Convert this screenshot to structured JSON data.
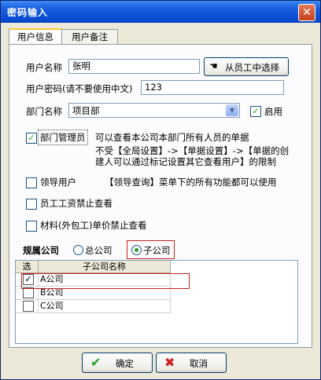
{
  "window": {
    "title": "密码输入",
    "close_symbol": "✕"
  },
  "tabs": [
    {
      "label": "用户信息"
    },
    {
      "label": "用户备注"
    }
  ],
  "form": {
    "username_label": "用户名称",
    "username_value": "张明",
    "select_employee_button": "从员工中选择",
    "password_label": "用户密码(请不要使用中文)",
    "password_value": "123",
    "department_label": "部门名称",
    "department_value": "项目部",
    "enable_label": "启用",
    "enable_checked": true
  },
  "permissions": {
    "dept_manager_label": "部门管理员",
    "dept_manager_checked": true,
    "dept_manager_desc1": "可以查看本公司本部门所有人员的单据",
    "dept_manager_desc2": "不受【全局设置】->【单据设置】->【单据的创",
    "dept_manager_desc3": "建人可以通过标记设置其它查看用户】的限制",
    "leader_label": "领导用户",
    "leader_desc": "【领导查询】菜单下的所有功能都可以使用",
    "salary_label": "员工工资禁止查看",
    "material_label": "材料(外包工)单价禁止查看"
  },
  "company": {
    "label": "规属公司",
    "option_head": "总公司",
    "option_sub": "子公司",
    "selected": "子公司"
  },
  "grid": {
    "col_select": "选",
    "col_name": "子公司名称",
    "rows": [
      {
        "checked": true,
        "name": "A公司"
      },
      {
        "checked": false,
        "name": "B公司"
      },
      {
        "checked": false,
        "name": "C公司"
      }
    ]
  },
  "buttons": {
    "ok": "确定",
    "cancel": "取消"
  },
  "colors": {
    "title_bar": "#0a4fd6",
    "check_green": "#21a121",
    "cancel_red": "#d02020",
    "highlight_red": "#d02020"
  }
}
